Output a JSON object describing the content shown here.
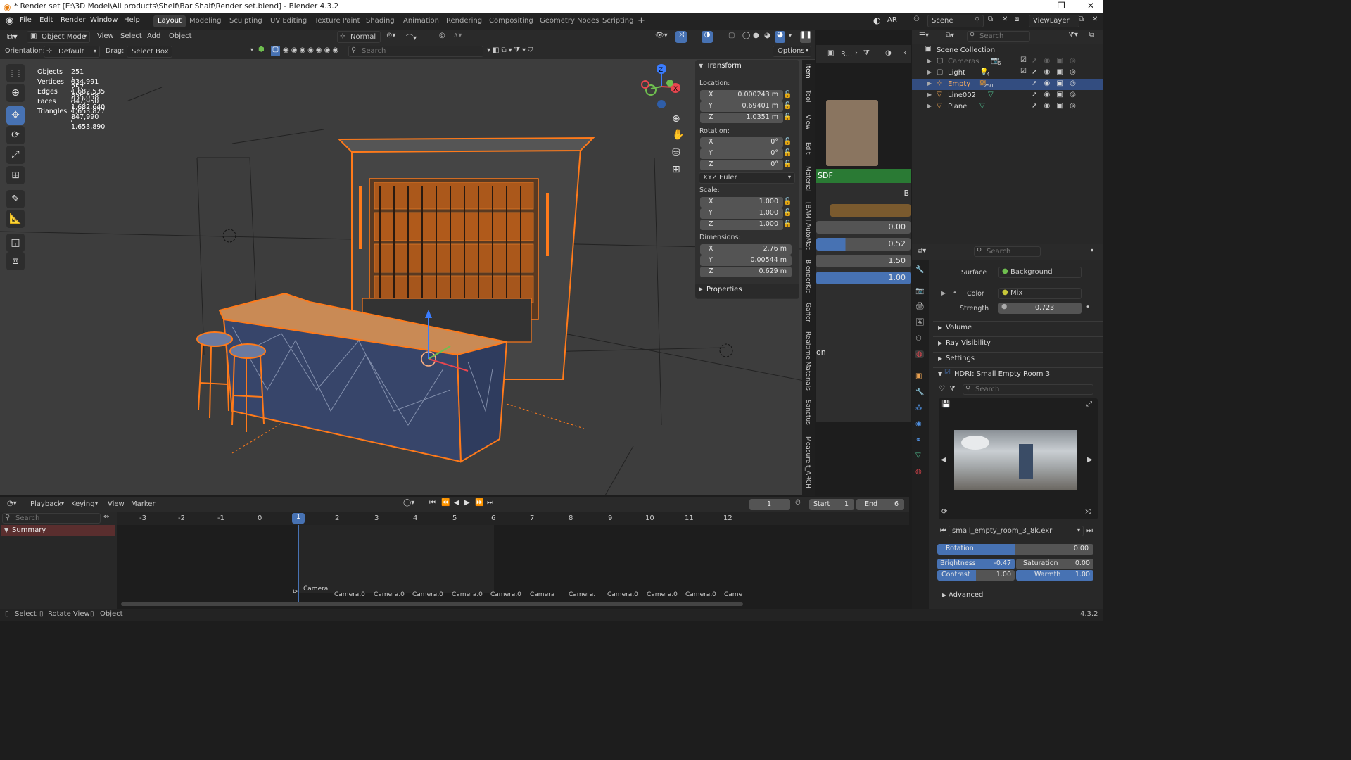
{
  "window": {
    "title": "* Render set [E:\\3D Model\\All products\\Shelf\\Bar Shalf\\Render set.blend] - Blender 4.3.2"
  },
  "menu": [
    "File",
    "Edit",
    "Render",
    "Window",
    "Help"
  ],
  "workspaces": [
    "Layout",
    "Modeling",
    "Sculpting",
    "UV Editing",
    "Texture Paint",
    "Shading",
    "Animation",
    "Rendering",
    "Compositing",
    "Geometry Nodes",
    "Scripting"
  ],
  "topright": {
    "engine": "AR",
    "scene": "Scene",
    "viewlayer": "ViewLayer"
  },
  "viewport_header": {
    "mode": "Object Mode",
    "menus": [
      "View",
      "Select",
      "Add",
      "Object"
    ],
    "transform_orient": "Normal",
    "search_placeholder": "Search",
    "object_label": "Object"
  },
  "viewport_header2": {
    "orientation_label": "Orientation:",
    "orientation_value": "Default",
    "drag_label": "Drag:",
    "drag_value": "Select Box",
    "search_placeholder": "Search",
    "options": "Options"
  },
  "stats": [
    {
      "label": "Objects",
      "value": "251 / 257"
    },
    {
      "label": "Vertices",
      "value": "834,991 / 835,058"
    },
    {
      "label": "Edges",
      "value": "1,682,535 / 1,682,640"
    },
    {
      "label": "Faces",
      "value": "847,950 / 847,990"
    },
    {
      "label": "Triangles",
      "value": "1,653,827 / 1,653,890"
    }
  ],
  "npanel": {
    "transform_title": "Transform",
    "location_label": "Location:",
    "location": [
      {
        "axis": "X",
        "value": "0.000243 m"
      },
      {
        "axis": "Y",
        "value": "0.69401 m"
      },
      {
        "axis": "Z",
        "value": "1.0351 m"
      }
    ],
    "rotation_label": "Rotation:",
    "rotation": [
      {
        "axis": "X",
        "value": "0°"
      },
      {
        "axis": "Y",
        "value": "0°"
      },
      {
        "axis": "Z",
        "value": "0°"
      }
    ],
    "rotation_mode": "XYZ Euler",
    "scale_label": "Scale:",
    "scale": [
      {
        "axis": "X",
        "value": "1.000"
      },
      {
        "axis": "Y",
        "value": "1.000"
      },
      {
        "axis": "Z",
        "value": "1.000"
      }
    ],
    "dimensions_label": "Dimensions:",
    "dimensions": [
      {
        "axis": "X",
        "value": "2.76 m"
      },
      {
        "axis": "Y",
        "value": "0.00544 m"
      },
      {
        "axis": "Z",
        "value": "0.629 m"
      }
    ],
    "properties_title": "Properties"
  },
  "side_tabs": [
    "Item",
    "Tool",
    "View",
    "Edit",
    "Material",
    "[BAM] AutoMat",
    "BlenderKit",
    "Gaffer",
    "Realtime Materials",
    "Sanctus",
    "MeasureIt_ARCH"
  ],
  "node_editor": {
    "header_label": "R...",
    "node_title": "SDF",
    "values": [
      "0.00",
      "0.52",
      "1.50",
      "1.00"
    ],
    "partial_b": "B",
    "partial_on": "on"
  },
  "outliner": {
    "search_placeholder": "Search",
    "root": "Scene Collection",
    "items": [
      {
        "name": "Cameras",
        "badge": "6"
      },
      {
        "name": "Light",
        "badge": "4"
      },
      {
        "name": "Empty",
        "badge": "250"
      },
      {
        "name": "Line002",
        "badge": ""
      },
      {
        "name": "Plane",
        "badge": ""
      }
    ]
  },
  "properties": {
    "search_placeholder": "Search",
    "surface_label": "Surface",
    "surface_value": "Background",
    "color_label": "Color",
    "color_value": "Mix",
    "strength_label": "Strength",
    "strength_value": "0.723",
    "sections": [
      "Volume",
      "Ray Visibility",
      "Settings"
    ],
    "hdri_title": "HDRI: Small Empty Room 3",
    "hdri_search": "Search",
    "hdri_file": "small_empty_room_3_8k.exr",
    "rotation_label": "Rotation",
    "rotation_value": "0.00",
    "rotation_fill": 0.5,
    "brightness_label": "Brightness",
    "brightness_value": "-0.47",
    "saturation_label": "Saturation",
    "saturation_value": "0.00",
    "contrast_label": "Contrast",
    "contrast_value": "1.00",
    "warmth_label": "Warmth",
    "warmth_value": "1.00",
    "advanced": "Advanced"
  },
  "timeline": {
    "menus": [
      "Playback",
      "Keying",
      "View",
      "Marker"
    ],
    "current_frame": "1",
    "start_label": "Start",
    "start_value": "1",
    "end_label": "End",
    "end_value": "6",
    "search_placeholder": "Search",
    "summary": "Summary",
    "ticks": [
      "-3",
      "-2",
      "-1",
      "0",
      "1",
      "2",
      "3",
      "4",
      "5",
      "6",
      "7",
      "8",
      "9",
      "10",
      "11",
      "12"
    ],
    "markers": [
      "Camera",
      "Camera.0",
      "Camera.0",
      "Camera.0",
      "Camera.0",
      "Camera.0",
      "Camera",
      "Camera.",
      "Camera.0",
      "Camera.0",
      "Camera.0",
      "Came"
    ]
  },
  "statusbar": {
    "items": [
      "Select",
      "Rotate View",
      "Object"
    ],
    "version": "4.3.2"
  },
  "colors": {
    "accent": "#4772b3",
    "selection": "#ff7a1a",
    "header": "#2a2a2a",
    "viewport": "#3d3d3d"
  }
}
